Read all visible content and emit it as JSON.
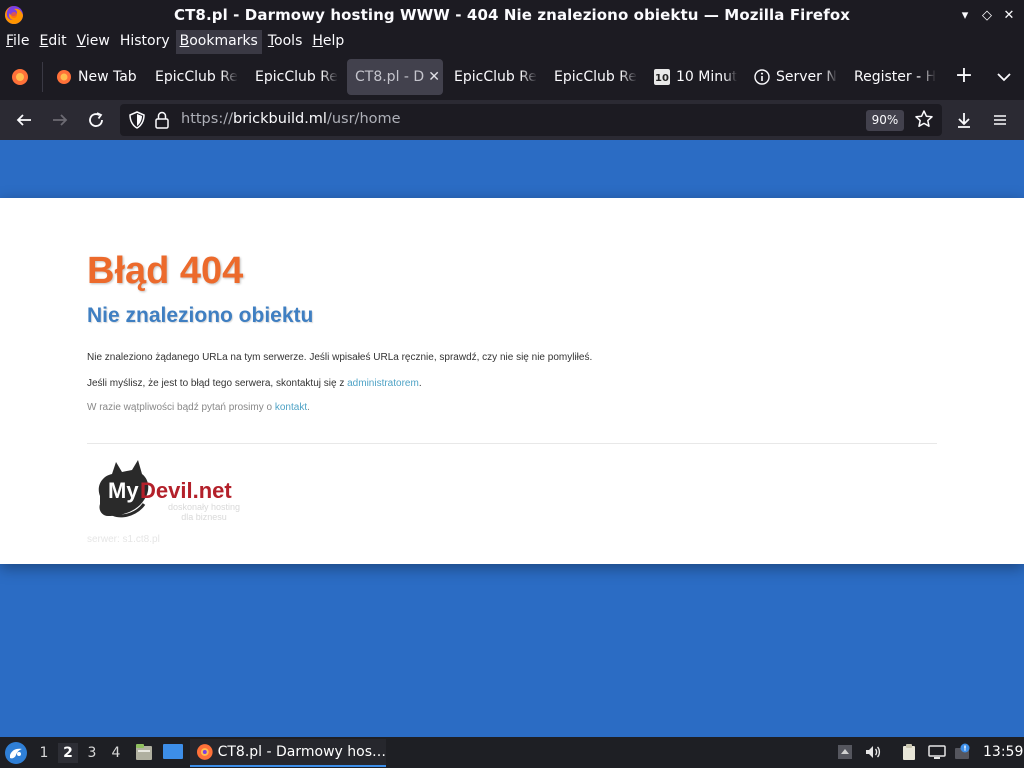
{
  "window": {
    "title": "CT8.pl - Darmowy hosting WWW - 404 Nie znaleziono obiektu — Mozilla Firefox",
    "controls": [
      "minimize-icon",
      "restore-icon",
      "close-icon"
    ]
  },
  "menubar": {
    "items": [
      {
        "label": "File",
        "accel": "F",
        "rest": "ile"
      },
      {
        "label": "Edit",
        "accel": "E",
        "rest": "dit"
      },
      {
        "label": "View",
        "accel": "V",
        "rest": "iew"
      },
      {
        "label": "History",
        "accel": "",
        "rest": "History"
      },
      {
        "label": "Bookmarks",
        "accel": "B",
        "rest": "ookmarks"
      },
      {
        "label": "Tools",
        "accel": "T",
        "rest": "ools"
      },
      {
        "label": "Help",
        "accel": "H",
        "rest": "elp"
      }
    ],
    "active_index": 4
  },
  "tabs": [
    {
      "label": "New Tab",
      "icon": "firefox-icon"
    },
    {
      "label": "EpicClub Re",
      "icon": ""
    },
    {
      "label": "EpicClub Re",
      "icon": ""
    },
    {
      "label": "CT8.pl - D",
      "icon": "",
      "selected": true
    },
    {
      "label": "EpicClub Re",
      "icon": ""
    },
    {
      "label": "EpicClub Re",
      "icon": ""
    },
    {
      "label": "10 Minut",
      "icon": "ten-minute-mail-icon"
    },
    {
      "label": "Server N",
      "icon": "info-icon"
    },
    {
      "label": "Register - H",
      "icon": ""
    }
  ],
  "navbar": {
    "url_scheme": "https://",
    "url_host": "brickbuild.ml",
    "url_path": "/usr/home",
    "zoom": "90%"
  },
  "page": {
    "error_title": "Błąd 404",
    "error_subtitle": "Nie znaleziono obiektu",
    "para1": "Nie znaleziono żądanego URLa na tym serwerze. Jeśli wpisałeś URLa ręcznie, sprawdź, czy nie się nie pomyliłeś.",
    "para2_text": "Jeśli myślisz, że jest to błąd tego serwera, skontaktuj się z ",
    "para2_link": "administratorem",
    "para2_end": ".",
    "para3_text": "W razie wątpliwości bądź pytań prosimy o ",
    "para3_link": "kontakt",
    "para3_end": ".",
    "logo_my": "My",
    "logo_devil": "Devil.net",
    "logo_tag1": "doskonały hosting",
    "logo_tag2": "dla biznesu",
    "server_label": "serwer: s1.ct8.pl"
  },
  "taskbar": {
    "workspaces": [
      "1",
      "2",
      "3",
      "4"
    ],
    "active_workspace": 1,
    "task_label": "CT8.pl - Darmowy hos…",
    "clock": "13:59"
  },
  "colors": {
    "page_bg": "#2b6cc4",
    "error_orange": "#ec6a2c",
    "subtitle_blue": "#3f7fc2",
    "link": "#4fa3c6",
    "chrome_dark": "#1c1b22"
  }
}
